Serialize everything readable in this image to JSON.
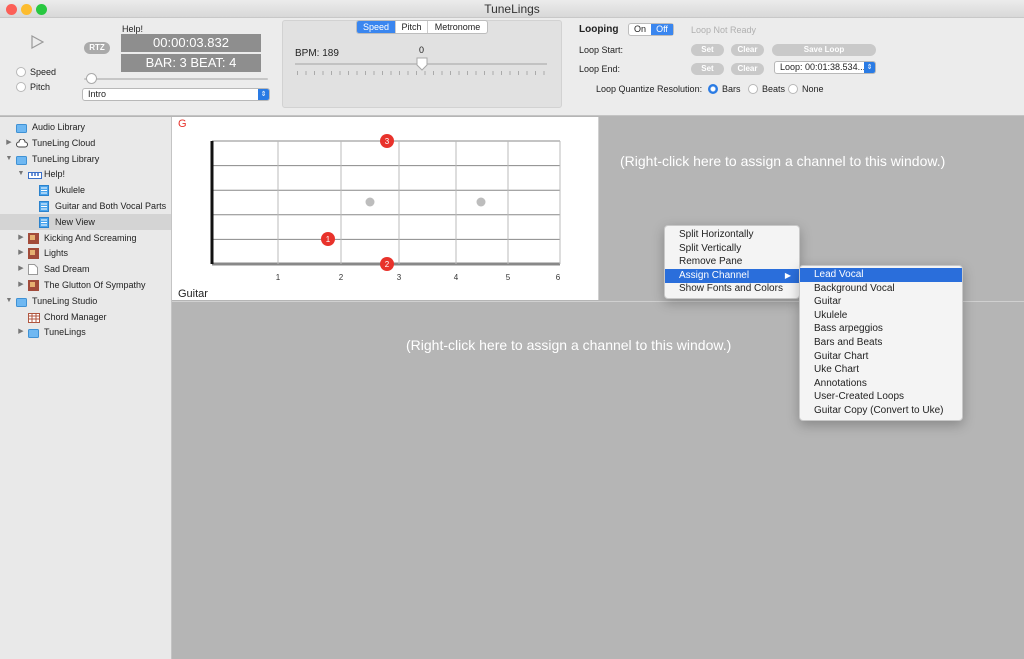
{
  "window": {
    "title": "TuneLings"
  },
  "transport": {
    "rtz_label": "RTZ",
    "speed_label": "Speed",
    "pitch_label": "Pitch",
    "song_label": "Help!",
    "time": "00:00:03.832",
    "bar_beat": "BAR: 3 BEAT: 4",
    "section_value": "Intro"
  },
  "tempo": {
    "tabs": [
      "Speed",
      "Pitch",
      "Metronome"
    ],
    "bpm_label": "BPM: 189",
    "slider_value": "0"
  },
  "looping": {
    "label": "Looping",
    "on_label": "On",
    "off_label": "Off",
    "status": "Loop Not Ready",
    "start_label": "Loop Start:",
    "end_label": "Loop End:",
    "set_label": "Set",
    "clear_label": "Clear",
    "save_label": "Save Loop",
    "loop_select": "Loop: 00:01:38.534...",
    "quantize_label": "Loop Quantize Resolution:",
    "options": [
      "Bars",
      "Beats",
      "None"
    ]
  },
  "sidebar": {
    "items": [
      {
        "label": "Audio Library",
        "level": 0,
        "icon": "folder-icon",
        "tri": ""
      },
      {
        "label": "TuneLing Cloud",
        "level": 0,
        "icon": "cloud-icon",
        "tri": "▶"
      },
      {
        "label": "TuneLing Library",
        "level": 0,
        "icon": "folder-icon",
        "tri": "▼"
      },
      {
        "label": "Help!",
        "level": 1,
        "icon": "piano-icon",
        "tri": "▼"
      },
      {
        "label": "Ukulele",
        "level": 2,
        "icon": "view-icon",
        "tri": ""
      },
      {
        "label": "Guitar and Both Vocal Parts",
        "level": 2,
        "icon": "view-icon",
        "tri": ""
      },
      {
        "label": "New View",
        "level": 2,
        "icon": "view-icon",
        "tri": ""
      },
      {
        "label": "Kicking And Screaming",
        "level": 1,
        "icon": "album-art-icon",
        "tri": "▶"
      },
      {
        "label": "Lights",
        "level": 1,
        "icon": "album-art-icon",
        "tri": "▶"
      },
      {
        "label": "Sad Dream",
        "level": 1,
        "icon": "document-icon",
        "tri": "▶"
      },
      {
        "label": "The Glutton Of Sympathy",
        "level": 1,
        "icon": "album-art-icon",
        "tri": "▶"
      },
      {
        "label": "TuneLing Studio",
        "level": 0,
        "icon": "folder-icon",
        "tri": "▼"
      },
      {
        "label": "Chord Manager",
        "level": 1,
        "icon": "chord-manager-icon",
        "tri": ""
      },
      {
        "label": "TuneLings",
        "level": 1,
        "icon": "folder-icon",
        "tri": "▶"
      }
    ]
  },
  "chart": {
    "chord_name": "G",
    "instrument": "Guitar",
    "fret_numbers": [
      "1",
      "2",
      "3",
      "4",
      "5",
      "6"
    ],
    "finger_labels": [
      "3",
      "1",
      "2"
    ]
  },
  "panes": {
    "right_hint": "(Right-click here to assign a channel to this window.)",
    "bottom_hint": "(Right-click here to assign a channel to this window.)"
  },
  "context_menu": {
    "items": [
      "Split Horizontally",
      "Split Vertically",
      "Remove Pane",
      "Assign Channel",
      "Show Fonts and Colors"
    ],
    "submenu_arrow": "▶"
  },
  "submenu": {
    "items": [
      "Lead Vocal",
      "Background Vocal",
      "Guitar",
      "Ukulele",
      "Bass arpeggios",
      "Bars and Beats",
      "Guitar Chart",
      "Uke Chart",
      "Annotations",
      "User-Created Loops",
      "Guitar Copy (Convert to Uke)"
    ]
  },
  "colors": {
    "accent": "#2a6edb",
    "finger_dot": "#e8322b",
    "chord_name": "#e8322b"
  }
}
